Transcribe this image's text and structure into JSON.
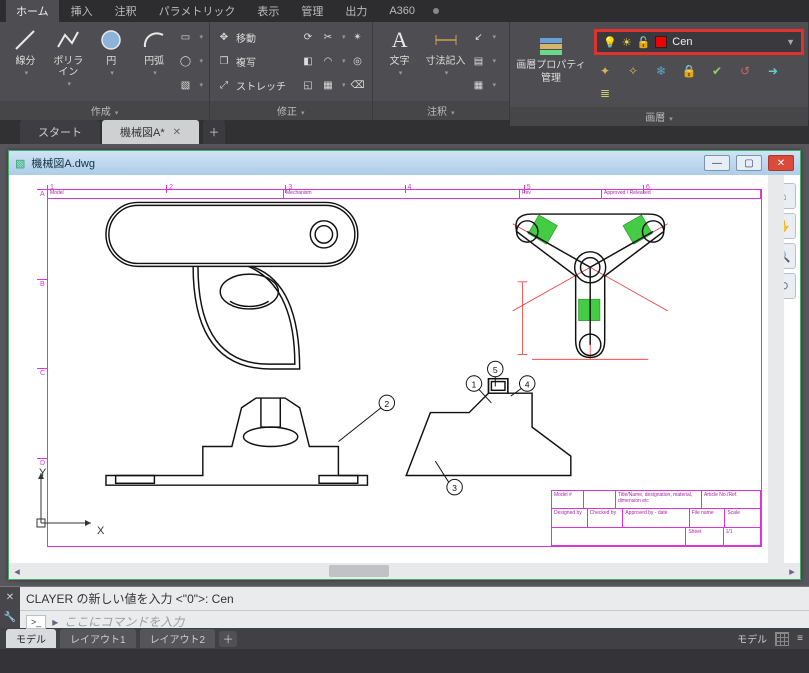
{
  "menu": [
    "ホーム",
    "挿入",
    "注釈",
    "パラメトリック",
    "表示",
    "管理",
    "出力",
    "A360"
  ],
  "menu_active": 0,
  "ribbon": {
    "create": {
      "label": "作成",
      "line": "線分",
      "polyline": "ポリライン",
      "circle": "円",
      "arc": "円弧"
    },
    "modify": {
      "label": "修正",
      "move": "移動",
      "copy": "複写",
      "stretch": "ストレッチ"
    },
    "annot": {
      "label": "注釈",
      "text": "文字",
      "dim": "寸法記入"
    },
    "layerpanel": {
      "label": "画層",
      "propmgr_l1": "画層プロパティ",
      "propmgr_l2": "管理"
    },
    "layerctl": {
      "name": "Cen"
    }
  },
  "doc_tabs": {
    "start": "スタート",
    "active": "機械図A*"
  },
  "child_window": {
    "title": "機械図A.dwg"
  },
  "command": {
    "history": "CLAYER の新しい値を入力 <\"0\">: Cen",
    "prompt_icon": ">_",
    "placeholder": "ここにコマンドを入力"
  },
  "layout_tabs": {
    "model": "モデル",
    "l1": "レイアウト1",
    "l2": "レイアウト2"
  },
  "status_right": {
    "model": "モデル"
  },
  "rulers": {
    "h": [
      "1",
      "2",
      "3",
      "4",
      "5",
      "6"
    ],
    "v": [
      "A",
      "B",
      "C",
      "D"
    ]
  },
  "titleblock": {
    "top": [
      "Model",
      "Mechanism"
    ],
    "top_right": [
      "Rev",
      "Approved / Released"
    ],
    "r1": [
      "Model #",
      "",
      "Title/Name, designation, material, dimension etc",
      "",
      "Article No./Ref."
    ],
    "r2": [
      "Designed by",
      "Checked by",
      "Approved by - date",
      "File name",
      "Scale"
    ],
    "r3": [
      "",
      "",
      "",
      "Sheet",
      "1/1"
    ]
  },
  "ucs": {
    "x": "X",
    "y": "Y"
  },
  "balloons": [
    "1",
    "2",
    "3",
    "4",
    "5"
  ]
}
